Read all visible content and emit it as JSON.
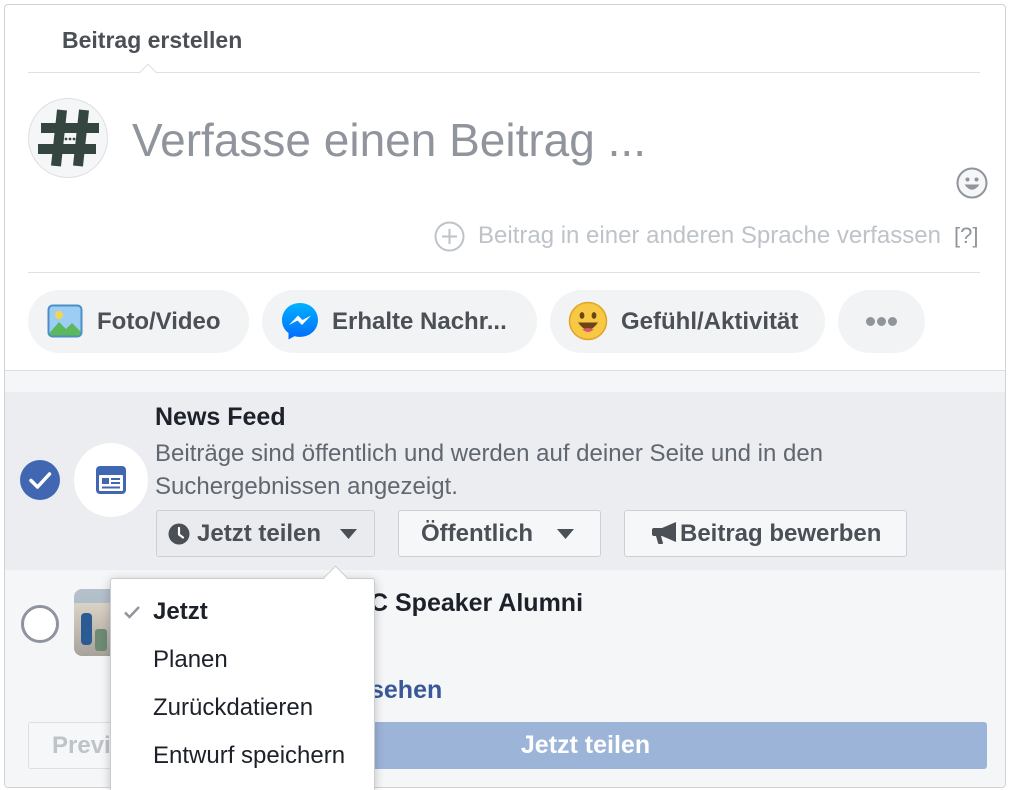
{
  "dialog": {
    "tab_label": "Beitrag erstellen",
    "composer": {
      "avatar_icon": "hashtag-icon",
      "placeholder": "Verfasse einen Beitrag ...",
      "emoji_icon": "emoji-picker-icon",
      "language_icon": "add-circle-icon",
      "language_link": "Beitrag in einer anderen Sprache verfassen",
      "help_label": "[?]"
    },
    "attachments": [
      {
        "label": "Foto/Video",
        "icon": "photo-icon"
      },
      {
        "label": "Erhalte Nachr...",
        "icon": "messenger-icon"
      },
      {
        "label": "Gefühl/Aktivität",
        "icon": "feeling-emoji-icon"
      },
      {
        "icon": "more-dots-icon"
      }
    ],
    "destinations": [
      {
        "title": "News Feed",
        "description": "Beiträge sind öffentlich und werden auf deiner Seite und in den Suchergebnissen angezeigt.",
        "selected": true,
        "icon": "news-feed-icon",
        "actions": {
          "share_timing": {
            "label": "Jetzt teilen",
            "icon": "clock-icon"
          },
          "audience": {
            "label": "Öffentlich",
            "icon": "chevron-down-icon"
          },
          "boost": {
            "label": "Beitrag bewerben",
            "icon": "megaphone-icon"
          }
        }
      },
      {
        "title": "C Speaker Alumni",
        "link": "sehen",
        "selected": false
      }
    ],
    "footer": {
      "preview_label": "Previ",
      "submit_label": "Jetzt teilen",
      "submit_enabled": false
    },
    "timing_menu": {
      "open": true,
      "items": [
        {
          "label": "Jetzt",
          "checked": true
        },
        {
          "label": "Planen",
          "checked": false
        },
        {
          "label": "Zurückdatieren",
          "checked": false
        },
        {
          "label": "Entwurf speichern",
          "checked": false
        }
      ]
    }
  },
  "colors": {
    "accent": "#4267b2",
    "submit_disabled": "#9cb4d8",
    "link": "#385898",
    "selected_row": "#ebedf0",
    "text_primary": "#1d2129",
    "text_secondary": "#606770",
    "placeholder": "#90949c"
  }
}
